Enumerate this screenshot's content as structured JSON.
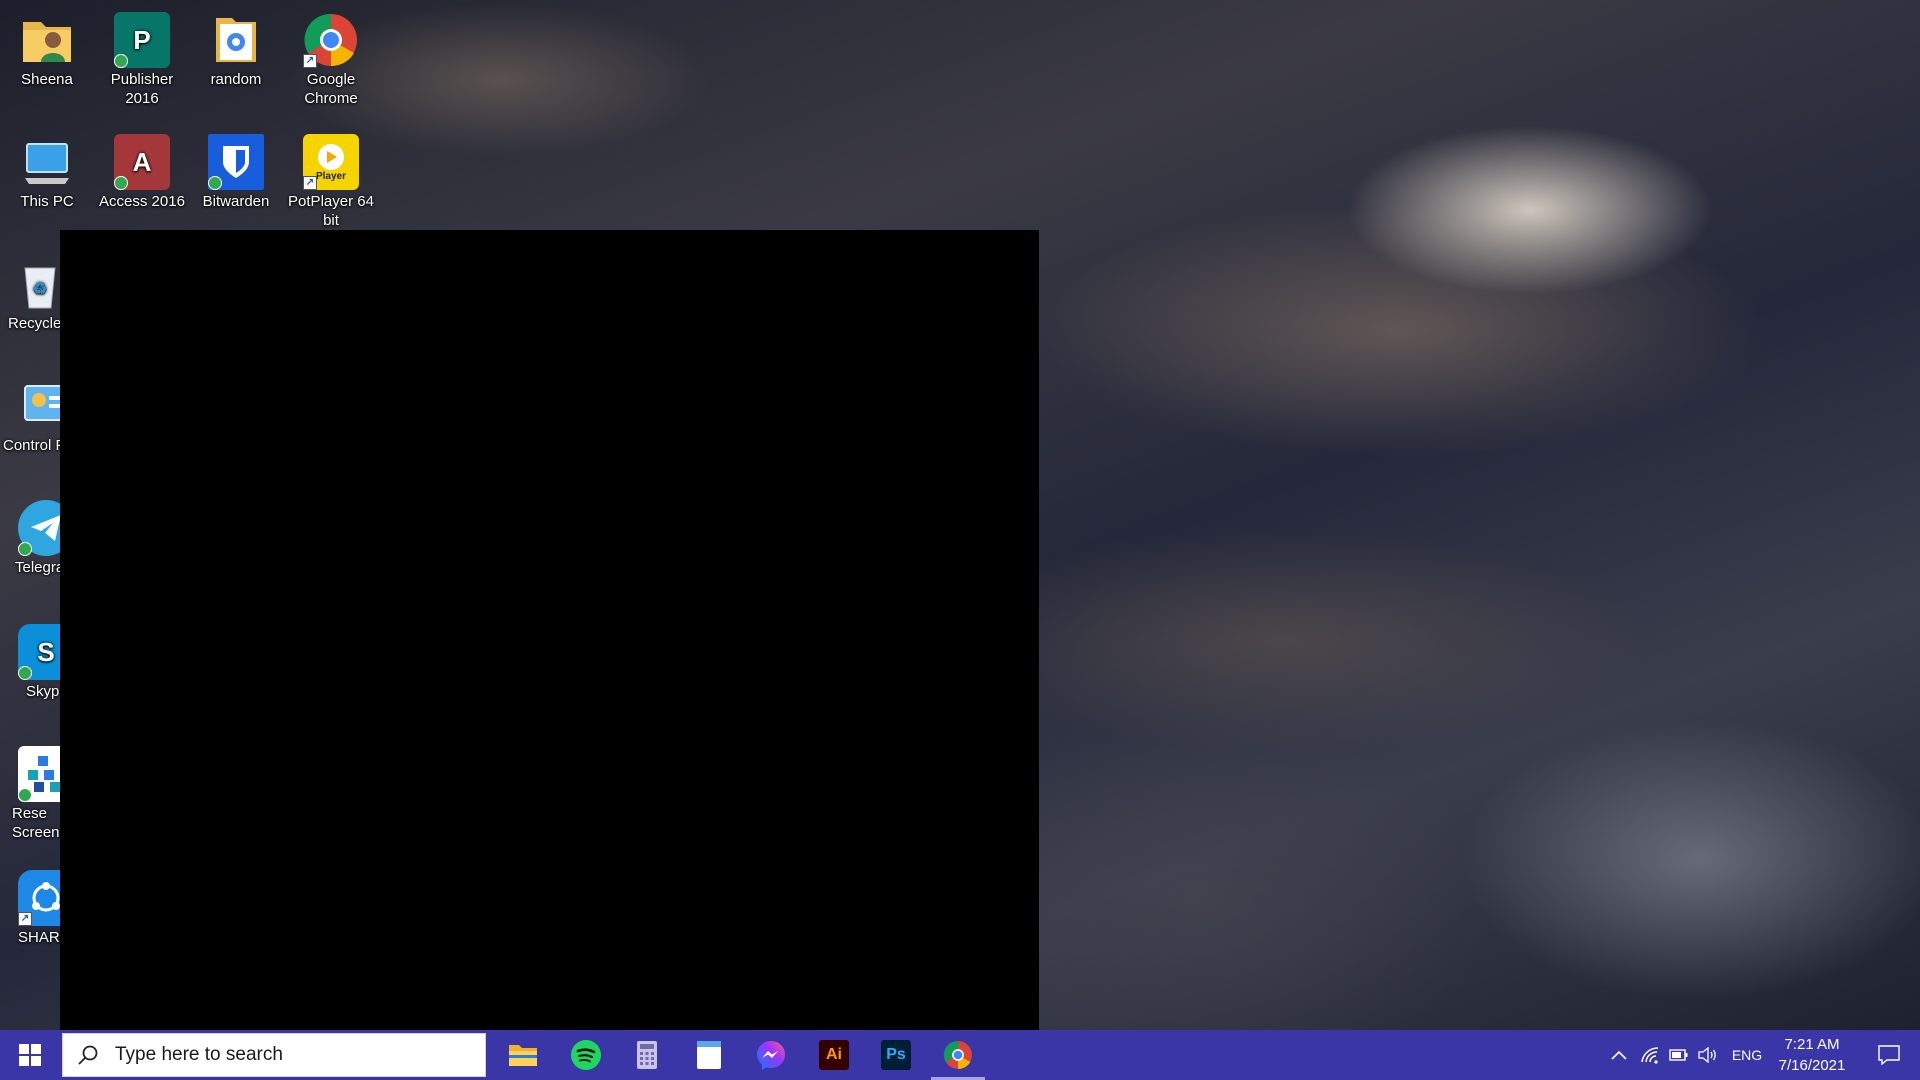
{
  "desktop": {
    "icons": [
      {
        "label": "Sheena"
      },
      {
        "label": "Publisher 2016"
      },
      {
        "label": "random"
      },
      {
        "label": "Google Chrome"
      },
      {
        "label": "This PC"
      },
      {
        "label": "Access 2016"
      },
      {
        "label": "Bitwarden"
      },
      {
        "label": "PotPlayer 64 bit"
      },
      {
        "label": "Recycle"
      },
      {
        "label": "Control P"
      },
      {
        "label": "Telegra"
      },
      {
        "label": "Skype"
      },
      {
        "label": "Rese Screens"
      },
      {
        "label": "SHARE"
      }
    ],
    "potplayer_badge": "Player"
  },
  "taskbar": {
    "search_placeholder": "Type here to search",
    "apps": [
      {
        "name": "File Explorer",
        "icon": "folder-icon"
      },
      {
        "name": "Spotify",
        "icon": "spotify-icon"
      },
      {
        "name": "Calculator",
        "icon": "calculator-icon"
      },
      {
        "name": "Notepad",
        "icon": "notepad-icon"
      },
      {
        "name": "Messenger",
        "icon": "messenger-icon"
      },
      {
        "name": "Illustrator",
        "icon": "illustrator-icon",
        "text": "Ai"
      },
      {
        "name": "Photoshop",
        "icon": "photoshop-icon",
        "text": "Ps"
      },
      {
        "name": "Google Chrome",
        "icon": "chrome-icon",
        "active": true
      }
    ],
    "tray": {
      "language": "ENG",
      "time": "7:21 AM",
      "date": "7/16/2021"
    }
  },
  "colors": {
    "taskbar": "#3b36a8",
    "publisher": "#077568",
    "access": "#a4373a",
    "bitwarden": "#175ddc",
    "potplayer": "#f5d400",
    "illustrator_bg": "#330000",
    "illustrator_fg": "#ff9a00",
    "photoshop_bg": "#001e36",
    "photoshop_fg": "#31a8ff"
  }
}
